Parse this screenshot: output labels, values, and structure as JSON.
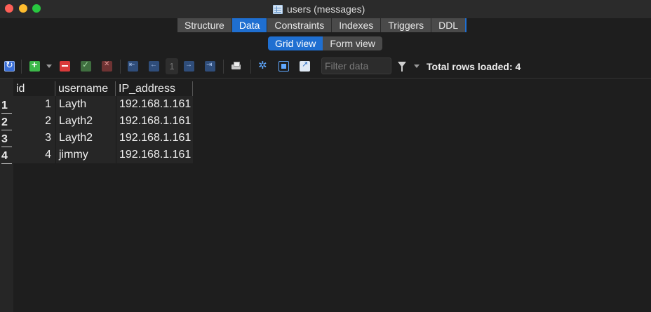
{
  "window": {
    "title": "users (messages)"
  },
  "tabs": [
    {
      "label": "Structure",
      "active": false
    },
    {
      "label": "Data",
      "active": true
    },
    {
      "label": "Constraints",
      "active": false
    },
    {
      "label": "Indexes",
      "active": false
    },
    {
      "label": "Triggers",
      "active": false
    },
    {
      "label": "DDL",
      "active": false
    }
  ],
  "views": [
    {
      "label": "Grid view",
      "active": true
    },
    {
      "label": "Form view",
      "active": false
    }
  ],
  "toolbar": {
    "page": "1",
    "filter_placeholder": "Filter data",
    "rows_loaded": "Total rows loaded: 4"
  },
  "grid": {
    "columns": [
      "id",
      "username",
      "IP_address"
    ],
    "rows": [
      {
        "num": "1",
        "id": "1",
        "username": "Layth",
        "ip": "192.168.1.161"
      },
      {
        "num": "2",
        "id": "2",
        "username": "Layth2",
        "ip": "192.168.1.161"
      },
      {
        "num": "3",
        "id": "3",
        "username": "Layth2",
        "ip": "192.168.1.161"
      },
      {
        "num": "4",
        "id": "4",
        "username": "jimmy",
        "ip": "192.168.1.161"
      }
    ]
  },
  "colors": {
    "accent": "#1f6fd1",
    "background": "#1e1e1e"
  }
}
